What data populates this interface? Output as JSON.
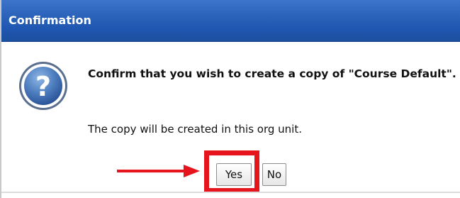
{
  "dialog": {
    "title": "Confirmation",
    "message": "Confirm that you wish to create a copy of \"Course Default\".",
    "note": "The copy will be created in this org unit.",
    "icon": "question-icon",
    "buttons": {
      "yes_label": "Yes",
      "no_label": "No"
    }
  },
  "annotation": {
    "arrow_icon": "right-arrow-icon",
    "highlight_color": "#e6141c"
  },
  "colors": {
    "titlebar": "#1f56b0",
    "title_text": "#ffffff"
  }
}
